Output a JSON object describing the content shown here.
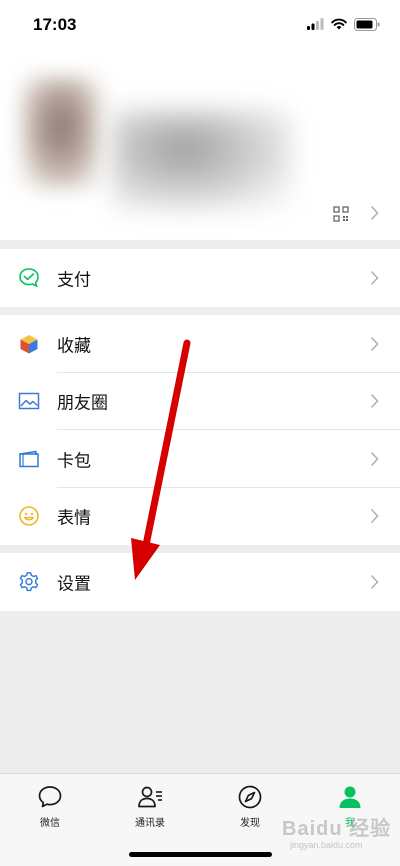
{
  "status_bar": {
    "time": "17:03"
  },
  "profile": {
    "qr_icon": "qr-code-icon",
    "chevron_icon": "chevron-right-icon"
  },
  "groups": [
    {
      "items": [
        {
          "label": "支付",
          "icon": "pay-icon",
          "icon_color": "#07c160"
        }
      ]
    },
    {
      "items": [
        {
          "label": "收藏",
          "icon": "favorites-cube-icon",
          "icon_color": "#e8a33d"
        },
        {
          "label": "朋友圈",
          "icon": "moments-photo-icon",
          "icon_color": "#4b7bd8"
        },
        {
          "label": "卡包",
          "icon": "card-wallet-icon",
          "icon_color": "#2f7ad8"
        },
        {
          "label": "表情",
          "icon": "smiley-icon",
          "icon_color": "#f0b729"
        }
      ]
    },
    {
      "items": [
        {
          "label": "设置",
          "icon": "gear-icon",
          "icon_color": "#2f7ad8"
        }
      ]
    }
  ],
  "tabbar": {
    "tabs": [
      {
        "label": "微信",
        "icon": "chat-bubble-icon"
      },
      {
        "label": "通讯录",
        "icon": "contacts-icon"
      },
      {
        "label": "发现",
        "icon": "compass-icon"
      },
      {
        "label": "我",
        "icon": "person-icon",
        "active": true
      }
    ]
  },
  "watermark": {
    "text": "Baidu 经验",
    "sub": "jingyan.baidu.com"
  },
  "colors": {
    "accent": "#07c160",
    "arrow": "#e00000",
    "background": "#ededed"
  }
}
